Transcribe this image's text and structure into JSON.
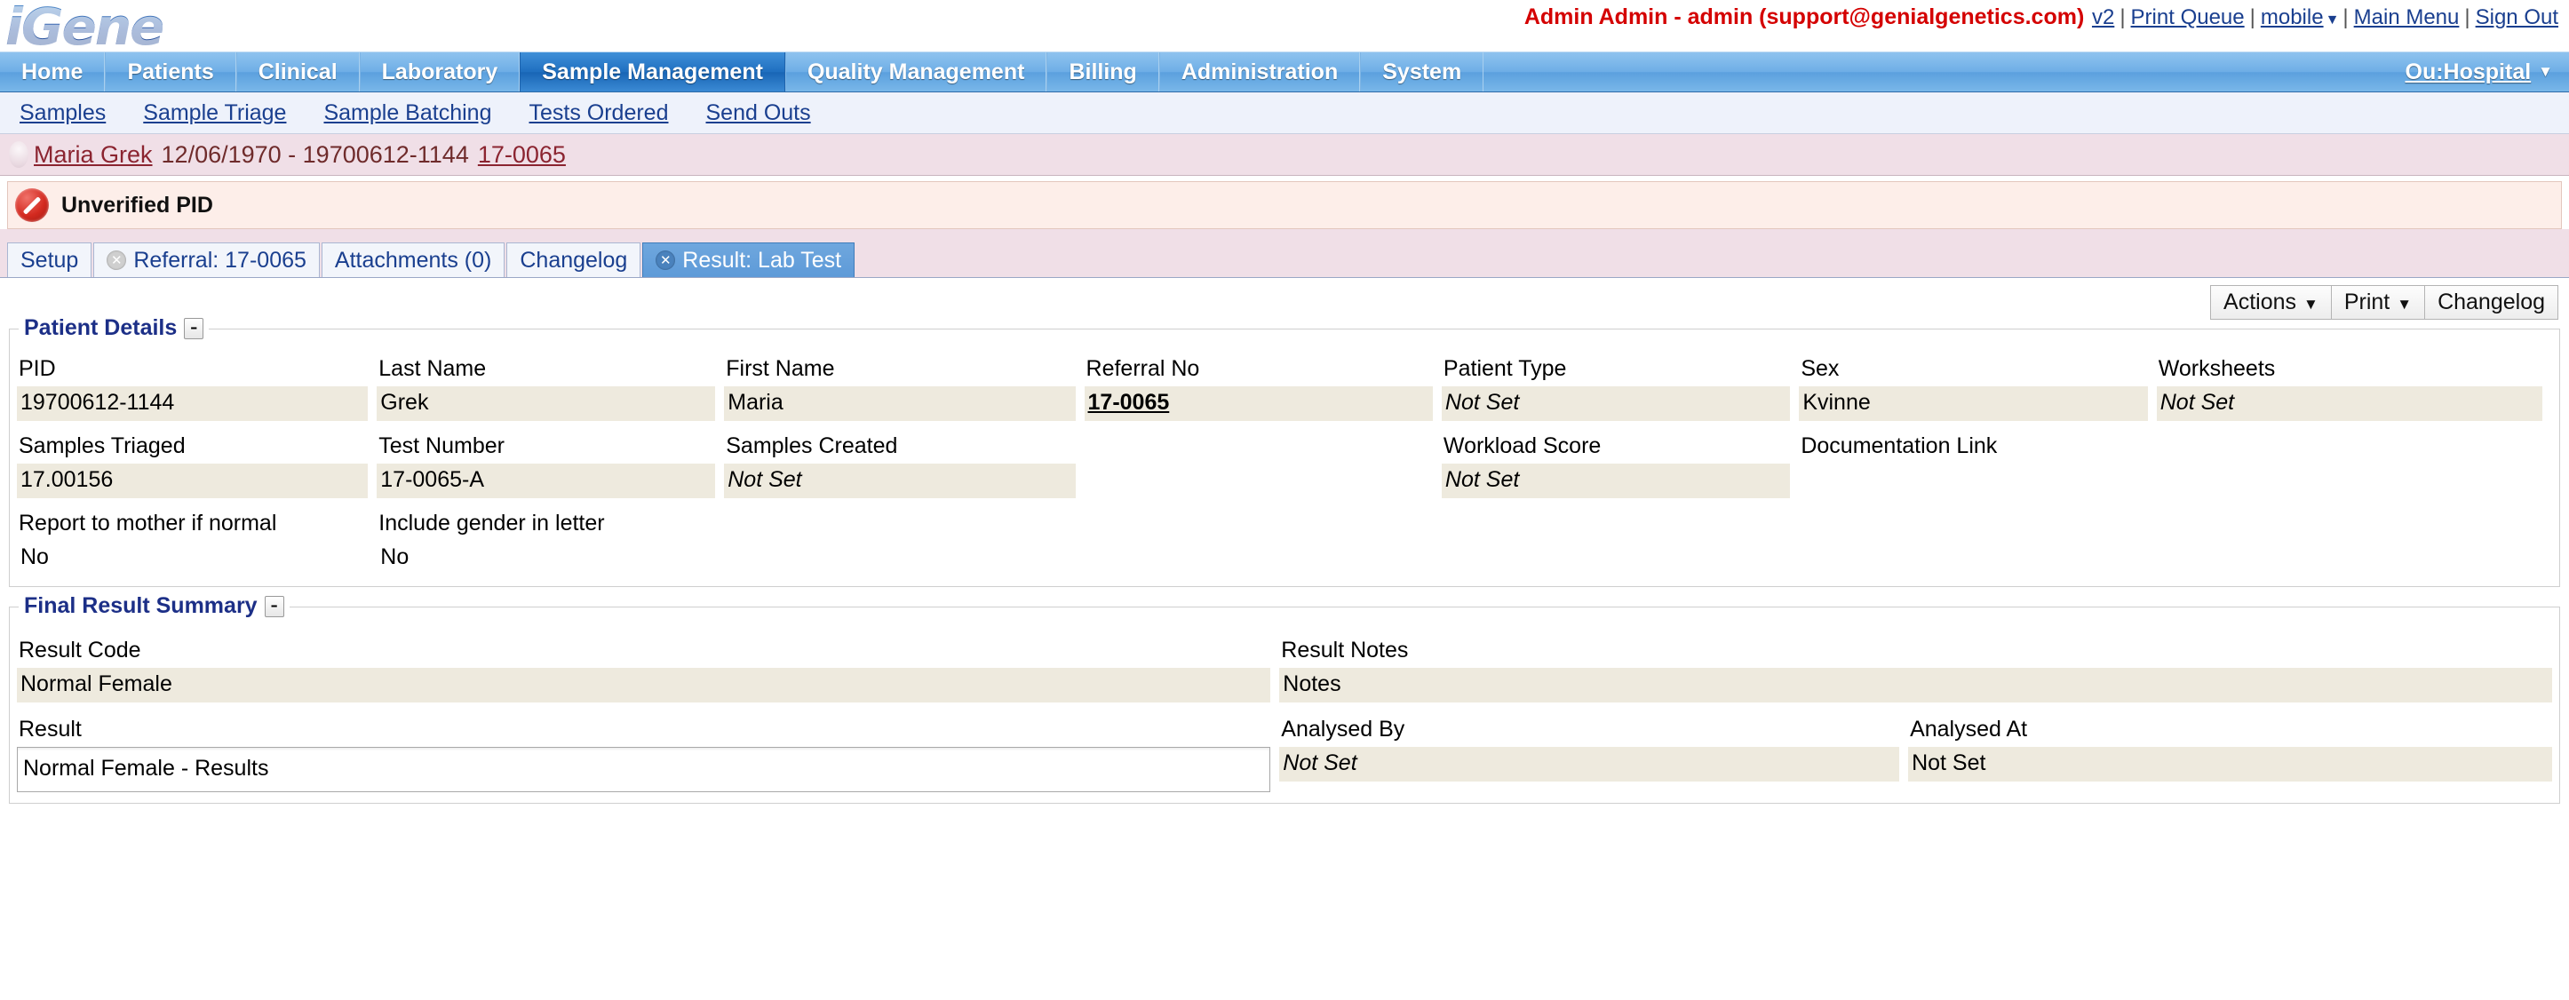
{
  "header": {
    "logo_text": "iGene",
    "user_label": "Admin Admin - admin (support@genialgenetics.com)",
    "links": [
      {
        "label": "v2",
        "name": "v2-link"
      },
      {
        "label": "Print Queue",
        "name": "print-queue-link"
      },
      {
        "label": "mobile",
        "name": "mobile-link"
      },
      {
        "label": "Main Menu",
        "name": "main-menu-link"
      },
      {
        "label": "Sign Out",
        "name": "sign-out-link"
      }
    ]
  },
  "mainnav": {
    "items": [
      {
        "label": "Home"
      },
      {
        "label": "Patients"
      },
      {
        "label": "Clinical"
      },
      {
        "label": "Laboratory"
      },
      {
        "label": "Sample Management"
      },
      {
        "label": "Quality Management"
      },
      {
        "label": "Billing"
      },
      {
        "label": "Administration"
      },
      {
        "label": "System"
      }
    ],
    "active_index": 4,
    "org_label": "Ou:Hospital",
    "org_caret": "▼"
  },
  "subnav": {
    "items": [
      {
        "label": "Samples"
      },
      {
        "label": "Sample Triage"
      },
      {
        "label": "Sample Batching"
      },
      {
        "label": "Tests Ordered"
      },
      {
        "label": "Send Outs"
      }
    ]
  },
  "patient_banner": {
    "name": "Maria Grek",
    "details": "12/06/1970 - 19700612-1144",
    "referral": "17-0065"
  },
  "alert": {
    "text": "Unverified PID"
  },
  "tabs": [
    {
      "label": "Setup",
      "closable": false,
      "active": false
    },
    {
      "label": "Referral: 17-0065",
      "closable": true,
      "active": false
    },
    {
      "label": "Attachments (0)",
      "closable": false,
      "active": false
    },
    {
      "label": "Changelog",
      "closable": false,
      "active": false
    },
    {
      "label": "Result: Lab Test",
      "closable": true,
      "active": true
    }
  ],
  "toolbar": {
    "actions_label": "Actions",
    "print_label": "Print",
    "changelog_label": "Changelog",
    "caret": "▼"
  },
  "patient_details": {
    "title": "Patient Details",
    "toggle": "–",
    "row1": [
      {
        "label": "PID",
        "value": "19700612-1144",
        "style": "normal"
      },
      {
        "label": "Last Name",
        "value": "Grek",
        "style": "normal"
      },
      {
        "label": "First Name",
        "value": "Maria",
        "style": "normal"
      },
      {
        "label": "Referral No",
        "value": "17-0065",
        "style": "link"
      },
      {
        "label": "Patient Type",
        "value": "Not Set",
        "style": "italic"
      },
      {
        "label": "Sex",
        "value": "Kvinne",
        "style": "normal"
      },
      {
        "label": "Worksheets",
        "value": "Not Set",
        "style": "italic"
      }
    ],
    "row2": [
      {
        "label": "Samples Triaged",
        "value": "17.00156",
        "style": "normal"
      },
      {
        "label": "Test Number",
        "value": "17-0065-A",
        "style": "normal"
      },
      {
        "label": "Samples Created",
        "value": "Not Set",
        "style": "italic"
      },
      {
        "label": "",
        "value": "",
        "style": "empty"
      },
      {
        "label": "Workload Score",
        "value": "Not Set",
        "style": "italic"
      },
      {
        "label": "Documentation Link",
        "value": "",
        "style": "empty"
      },
      {
        "label": "",
        "value": "",
        "style": "empty"
      }
    ],
    "row3": [
      {
        "label": "Report to mother if normal",
        "value": "No",
        "style": "plain"
      },
      {
        "label": "Include gender in letter",
        "value": "No",
        "style": "plain"
      }
    ]
  },
  "final_result_summary": {
    "title": "Final Result Summary",
    "toggle": "–",
    "row1": [
      {
        "label": "Result Code",
        "value": "Normal Female",
        "style": "normal"
      },
      {
        "label": "Result Notes",
        "value": "Notes",
        "style": "normal"
      }
    ],
    "row2": [
      {
        "label": "Result",
        "value": "Normal Female - Results",
        "style": "textbox"
      },
      {
        "label": "Analysed By",
        "value": "Not Set",
        "style": "italic"
      },
      {
        "label": "Analysed At",
        "value": "Not Set",
        "style": "normal"
      }
    ]
  }
}
